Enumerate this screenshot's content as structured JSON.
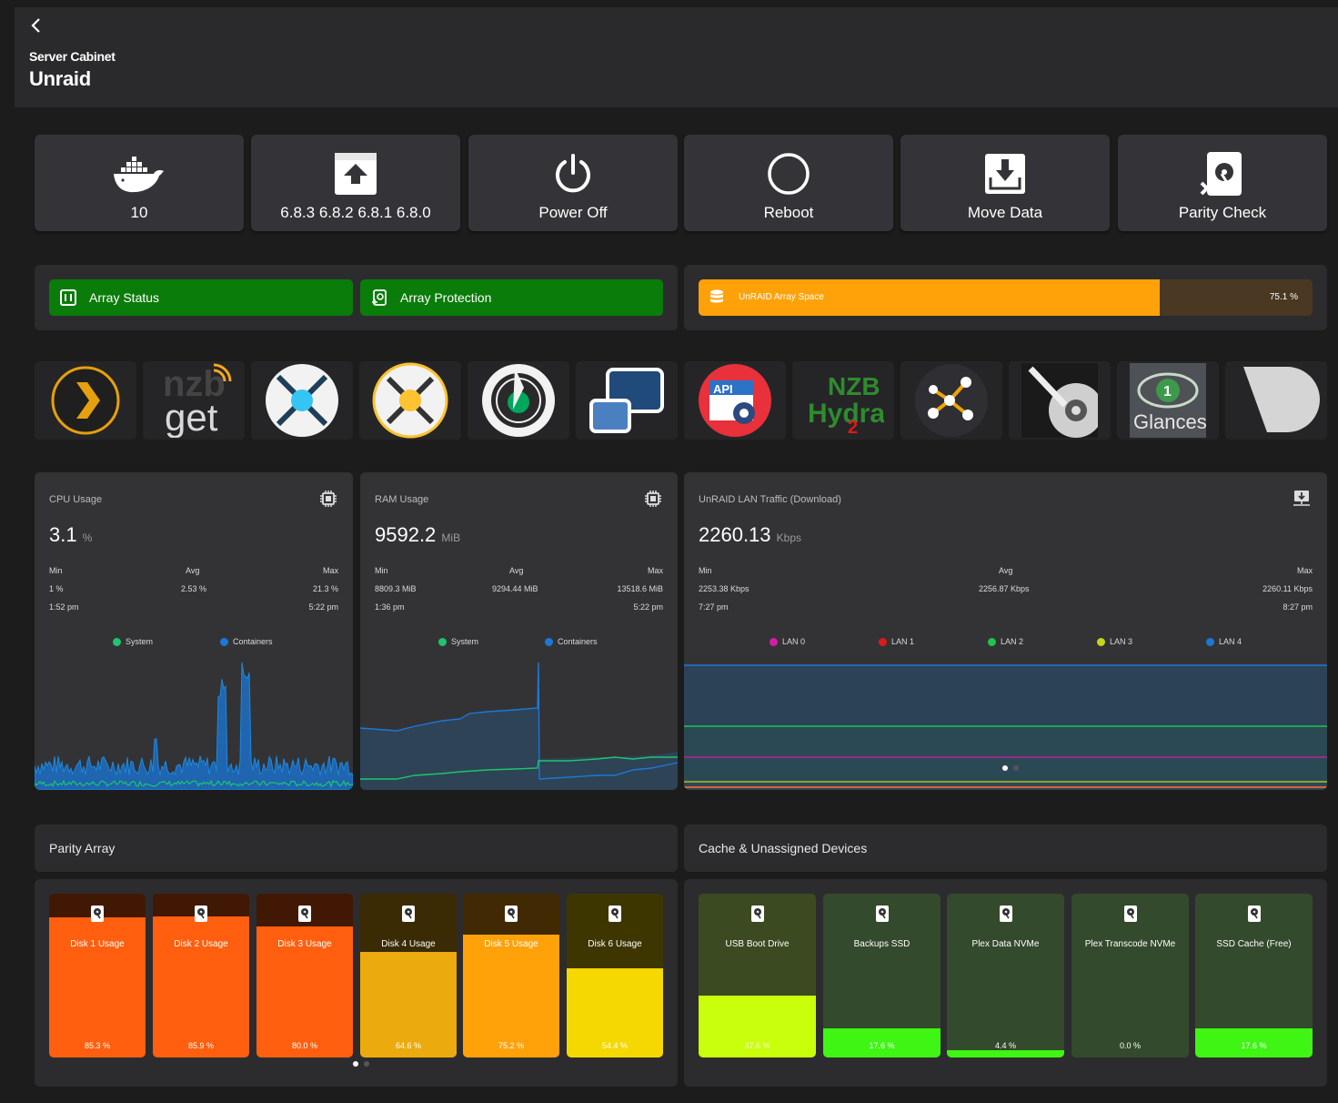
{
  "header": {
    "subtitle": "Server Cabinet",
    "title": "Unraid"
  },
  "actions": [
    {
      "label": "10",
      "icon": "docker-icon"
    },
    {
      "label": "6.8.3 6.8.2 6.8.1 6.8.0",
      "icon": "upload-icon"
    },
    {
      "label": "Power Off",
      "icon": "power-icon"
    },
    {
      "label": "Reboot",
      "icon": "reboot-icon"
    },
    {
      "label": "Move Data",
      "icon": "move-data-icon"
    },
    {
      "label": "Parity Check",
      "icon": "parity-check-icon"
    }
  ],
  "status": {
    "array_status": "Array Status",
    "array_protection": "Array Protection",
    "space_label": "UnRAID Array Space",
    "space_pct": "75.1 %",
    "space_fraction": 0.751,
    "ok_color": "#0a7c0a",
    "space_color": "#ffa20a"
  },
  "apps": {
    "nzb": "nzb",
    "get": "get",
    "api": "API",
    "nzb_hydra_top": "NZB",
    "nzb_hydra_bottom": "Hydra",
    "hydra_num": "2",
    "glances_num": "1",
    "glances": "Glances"
  },
  "cpu": {
    "title": "CPU Usage",
    "value": "3.1",
    "unit": "%",
    "min_label": "Min",
    "avg_label": "Avg",
    "max_label": "Max",
    "min": "1 %",
    "avg": "2.53 %",
    "max": "21.3 %",
    "min_time": "1:52 pm",
    "max_time": "5:22 pm",
    "legend": [
      "System",
      "Containers"
    ]
  },
  "ram": {
    "title": "RAM Usage",
    "value": "9592.2",
    "unit": "MiB",
    "min_label": "Min",
    "avg_label": "Avg",
    "max_label": "Max",
    "min": "8809.3 MiB",
    "avg": "9294.44 MiB",
    "max": "13518.6 MiB",
    "min_time": "1:36 pm",
    "max_time": "5:22 pm",
    "legend": [
      "System",
      "Containers"
    ]
  },
  "lan": {
    "title": "UnRAID LAN Traffic (Download)",
    "value": "2260.13",
    "unit": "Kbps",
    "min_label": "Min",
    "avg_label": "Avg",
    "max_label": "Max",
    "min": "2253.38 Kbps",
    "avg": "2256.87 Kbps",
    "max": "2260.11 Kbps",
    "min_time": "7:27 pm",
    "max_time": "8:27 pm",
    "legend": [
      "LAN 0",
      "LAN 1",
      "LAN 2",
      "LAN 3",
      "LAN 4"
    ],
    "legend_colors": [
      "#d61ca6",
      "#e01818",
      "#1ec44e",
      "#c8d41c",
      "#1c78d6"
    ]
  },
  "sections": {
    "parity": "Parity Array",
    "cache": "Cache & Unassigned Devices"
  },
  "parity_disks": [
    {
      "label": "Disk 1 Usage",
      "pct": "85.3 %",
      "value": 0.853,
      "color": "#ff5f0f"
    },
    {
      "label": "Disk 2 Usage",
      "pct": "85.9 %",
      "value": 0.859,
      "color": "#ff5f0f"
    },
    {
      "label": "Disk 3 Usage",
      "pct": "80.0 %",
      "value": 0.8,
      "color": "#ff5f0f"
    },
    {
      "label": "Disk 4 Usage",
      "pct": "64.6 %",
      "value": 0.646,
      "color": "#ebab0e"
    },
    {
      "label": "Disk 5 Usage",
      "pct": "75.2 %",
      "value": 0.752,
      "color": "#ffa20a"
    },
    {
      "label": "Disk 6 Usage",
      "pct": "54.4 %",
      "value": 0.544,
      "color": "#f5d800"
    }
  ],
  "cache_disks": [
    {
      "label": "USB Boot Drive",
      "pct": "37.6 %",
      "value": 0.376,
      "color": "#c9ff0a"
    },
    {
      "label": "Backups SSD",
      "pct": "17.6 %",
      "value": 0.176,
      "color": "#3ff514"
    },
    {
      "label": "Plex Data NVMe",
      "pct": "4.4 %",
      "value": 0.044,
      "color": "#3ff514"
    },
    {
      "label": "Plex Transcode NVMe",
      "pct": "0.0 %",
      "value": 0.0,
      "color": "#3ff514"
    },
    {
      "label": "SSD Cache (Free)",
      "pct": "17.6 %",
      "value": 0.176,
      "color": "#3ff514"
    }
  ]
}
